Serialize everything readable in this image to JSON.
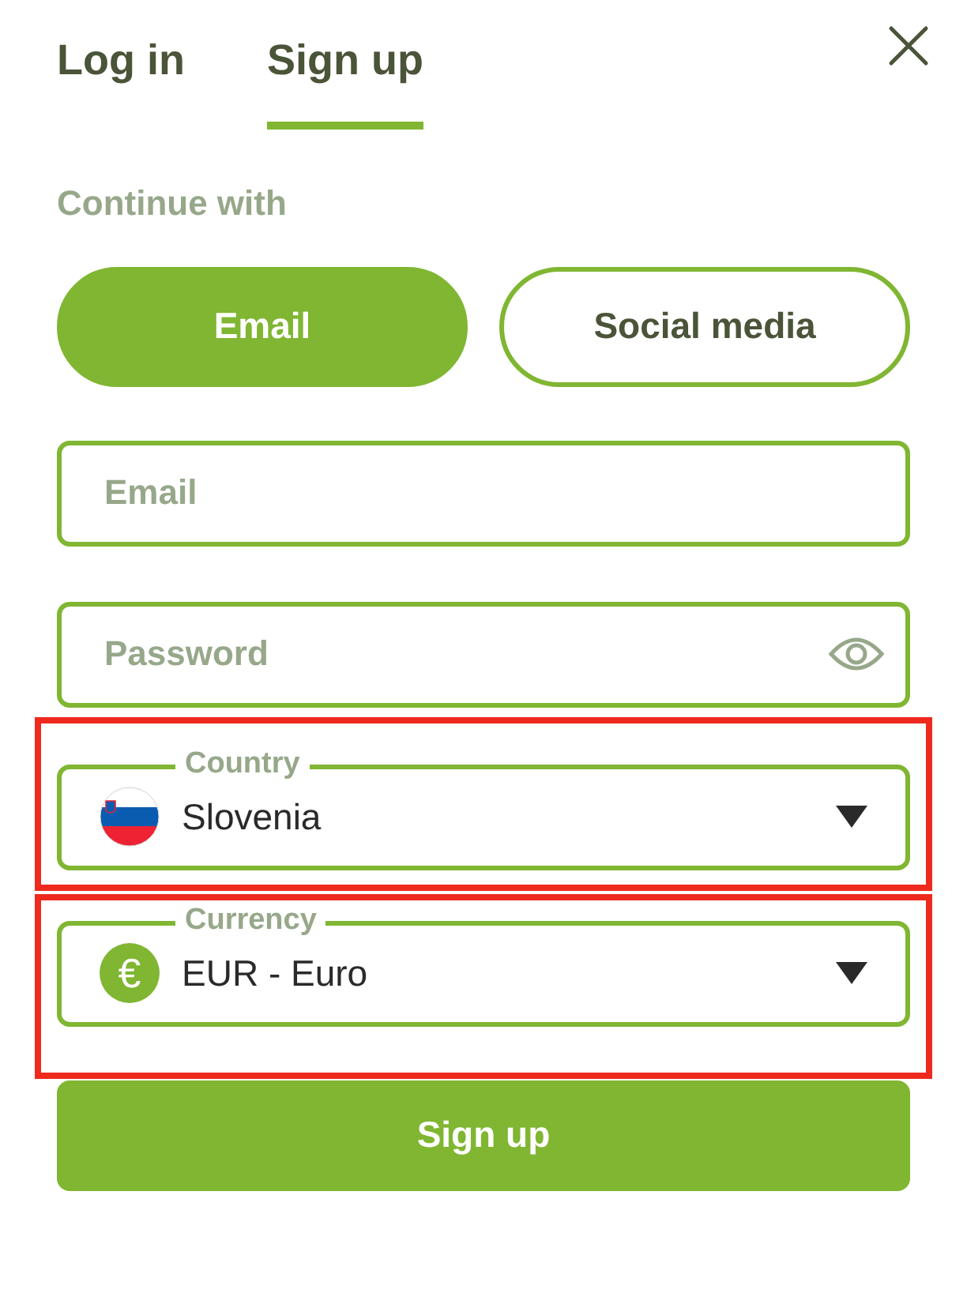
{
  "tabs": [
    {
      "label": "Log in",
      "selected": false
    },
    {
      "label": "Sign up",
      "selected": true
    }
  ],
  "continue_label": "Continue with",
  "methods": [
    {
      "label": "Email",
      "selected": true
    },
    {
      "label": "Social media",
      "selected": false
    }
  ],
  "fields": [
    {
      "placeholder": "Email",
      "kind": "text"
    },
    {
      "placeholder": "Password",
      "kind": "password"
    }
  ],
  "selects": [
    {
      "label": "Country",
      "value": "Slovenia",
      "kind": "flag",
      "highlighted": true
    },
    {
      "label": "Currency",
      "value": "EUR - Euro",
      "kind": "currency",
      "icon_text": "€",
      "highlighted": true
    }
  ],
  "submit": "Sign up"
}
